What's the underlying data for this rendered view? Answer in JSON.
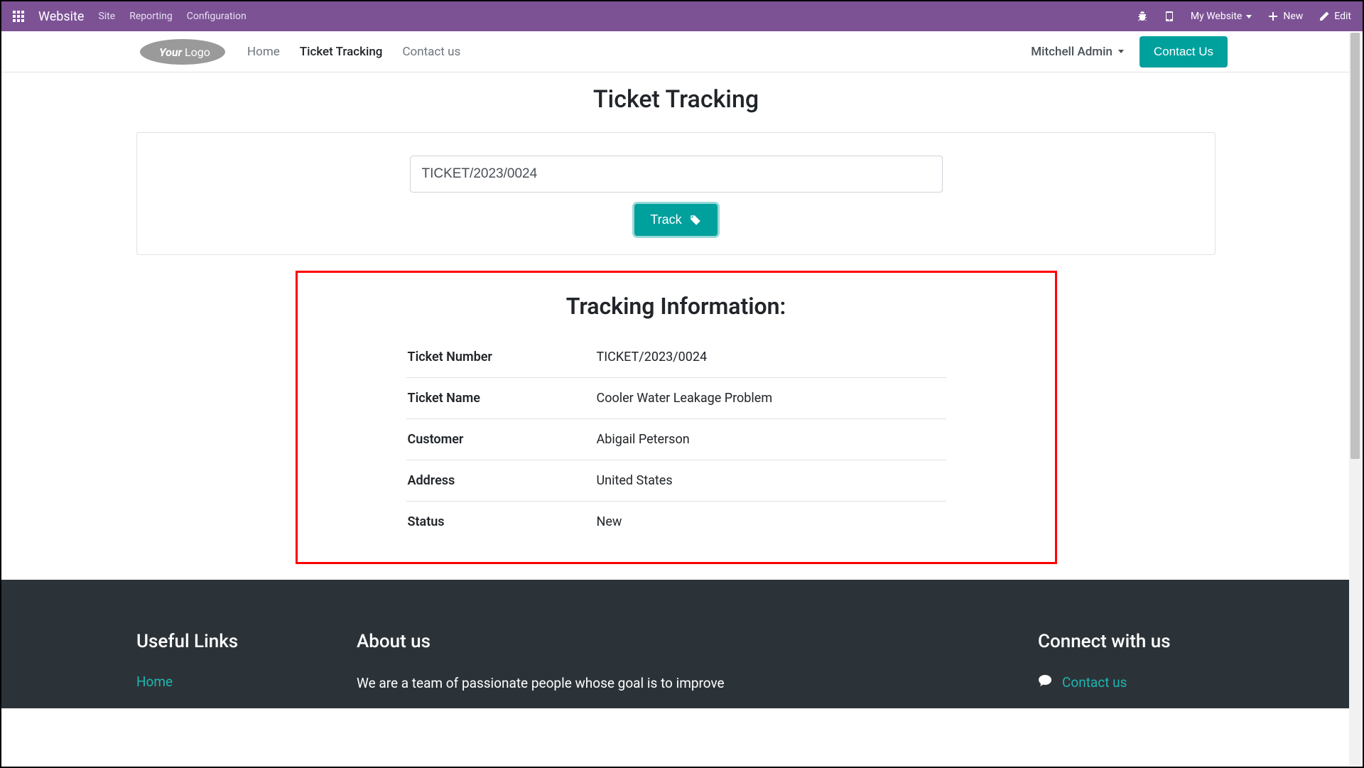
{
  "topbar": {
    "brand": "Website",
    "menu": [
      "Site",
      "Reporting",
      "Configuration"
    ],
    "right": {
      "my_website": "My Website",
      "new": "New",
      "edit": "Edit"
    }
  },
  "sitenav": {
    "links": [
      "Home",
      "Ticket Tracking",
      "Contact us"
    ],
    "active_index": 1,
    "user": "Mitchell Admin",
    "contact_btn": "Contact Us"
  },
  "page": {
    "title": "Ticket Tracking",
    "input_value": "TICKET/2023/0024",
    "track_btn": "Track"
  },
  "tracking": {
    "heading": "Tracking Information:",
    "rows": [
      {
        "label": "Ticket Number",
        "value": "TICKET/2023/0024"
      },
      {
        "label": "Ticket Name",
        "value": "Cooler Water Leakage Problem"
      },
      {
        "label": "Customer",
        "value": "Abigail Peterson"
      },
      {
        "label": "Address",
        "value": "United States"
      },
      {
        "label": "Status",
        "value": "New"
      }
    ]
  },
  "footer": {
    "useful": {
      "title": "Useful Links",
      "links": [
        "Home"
      ]
    },
    "about": {
      "title": "About us",
      "text": "We are a team of passionate people whose goal is to improve"
    },
    "connect": {
      "title": "Connect with us",
      "links": [
        "Contact us"
      ]
    }
  },
  "logo_text": {
    "a": "Your",
    "b": "Logo"
  }
}
